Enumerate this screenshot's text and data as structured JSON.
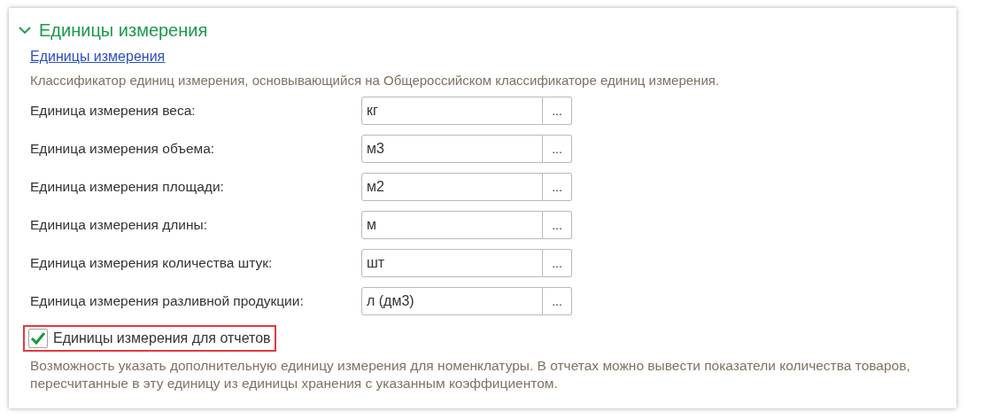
{
  "section": {
    "title": "Единицы измерения",
    "expanded": true,
    "link": "Единицы измерения",
    "description": "Классификатор единиц измерения, основывающийся на Общероссийском классификаторе единиц измерения.",
    "fields": [
      {
        "label": "Единица измерения веса:",
        "value": "кг",
        "button": "..."
      },
      {
        "label": "Единица измерения объема:",
        "value": "м3",
        "button": "..."
      },
      {
        "label": "Единица измерения площади:",
        "value": "м2",
        "button": "..."
      },
      {
        "label": "Единица измерения длины:",
        "value": "м",
        "button": "..."
      },
      {
        "label": "Единица измерения количества штук:",
        "value": "шт",
        "button": "..."
      },
      {
        "label": "Единица измерения разливной продукции:",
        "value": "л (дм3)",
        "button": "..."
      }
    ],
    "option": {
      "label": "Единицы измерения для отчетов",
      "checked": true,
      "highlighted": true
    },
    "note": "Возможность указать дополнительную единицу измерения для номенклатуры. В отчетах можно вывести показатели количества товаров, пересчитанные в эту единицу из единицы хранения с указанным коэффициентом."
  }
}
